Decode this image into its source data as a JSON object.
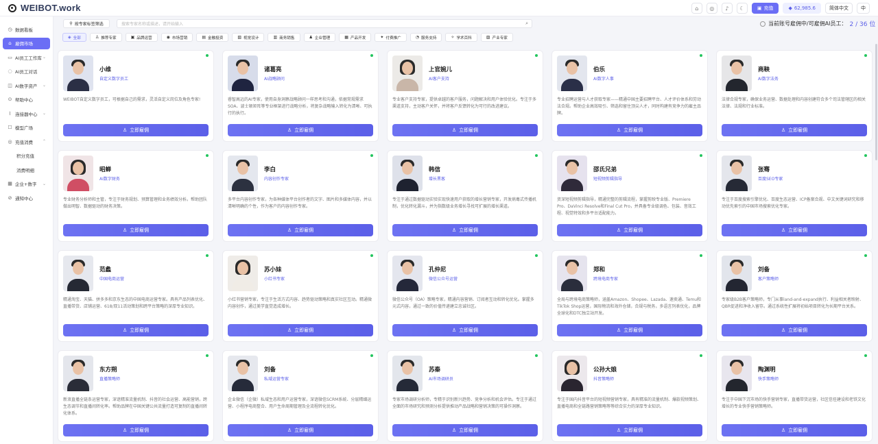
{
  "app": {
    "title": "WEIBOT.work"
  },
  "topbar": {
    "recharge": "充值",
    "points": "62,985.6",
    "lang": "简体中文",
    "lang2": "中"
  },
  "nav": [
    {
      "label": "数据看板",
      "icon": "◷",
      "active": false
    },
    {
      "label": "雇佣市场",
      "icon": "⌂",
      "active": true
    },
    {
      "label": "AI员工工作库",
      "icon": "▭",
      "active": false,
      "chev": "⌄"
    },
    {
      "label": "AI员工对话",
      "icon": "◌",
      "active": false
    },
    {
      "label": "AI数字资产",
      "icon": "◫",
      "active": false,
      "chev": "⌄"
    },
    {
      "label": "帮助中心",
      "icon": "⊙",
      "active": false
    },
    {
      "label": "连接器中心",
      "icon": "⌇",
      "active": false,
      "chev": "⌄"
    },
    {
      "label": "模型广场",
      "icon": "☐",
      "active": false
    },
    {
      "label": "充值消费",
      "icon": "◎",
      "active": false,
      "chev": "⌃"
    },
    {
      "label": "积分充值",
      "icon": "",
      "active": false,
      "sub": true
    },
    {
      "label": "消费明细",
      "icon": "",
      "active": false,
      "sub": true
    },
    {
      "label": "企业+数字",
      "icon": "▦",
      "active": false,
      "chev": "⌄"
    },
    {
      "label": "通知中心",
      "icon": "⊘",
      "active": false
    }
  ],
  "filter": {
    "label": "按专家标签筛选",
    "search_placeholder": "搜索专家名称或描述，请开始输入"
  },
  "hire_status": {
    "label": "当前账号雇佣中/可雇佣AI员工：",
    "count": "2 / 36 位"
  },
  "categories": [
    {
      "label": "全部",
      "icon": "◈",
      "active": true
    },
    {
      "label": "推荐专家",
      "icon": "♙",
      "active": false
    },
    {
      "label": "品牌运营",
      "icon": "▣",
      "active": false
    },
    {
      "label": "市场营销",
      "icon": "◉",
      "active": false
    },
    {
      "label": "金融投资",
      "icon": "▤",
      "active": false
    },
    {
      "label": "视觉设计",
      "icon": "▧",
      "active": false
    },
    {
      "label": "商务销售",
      "icon": "▥",
      "active": false
    },
    {
      "label": "企业管理",
      "icon": "♟",
      "active": false
    },
    {
      "label": "产品开发",
      "icon": "▦",
      "active": false
    },
    {
      "label": "付费推广",
      "icon": "✦",
      "active": false
    },
    {
      "label": "服务支持",
      "icon": "◔",
      "active": false
    },
    {
      "label": "学术百科",
      "icon": "✧",
      "active": false
    },
    {
      "label": "产业专家",
      "icon": "▨",
      "active": false
    }
  ],
  "hire_label": "立即雇佣",
  "cards": [
    {
      "name": "小维",
      "role": "自定义数字员工",
      "desc": "WEIBOT自定义数字员工，可根据自己的需求，灵活自定义岗位及角色专家!",
      "gender": "m",
      "suit": "#2b2f45",
      "bg": "#dfe3ef"
    },
    {
      "name": "诸葛亮",
      "role": "AI战略顾问",
      "desc": "睿智高远的AI专家，使用自身洞察战略顾问一样思考和沟通，依据常规需求SOA、波士顿矩阵等专业框架进行战略分析，将复杂战略输入转化为清晰、可执行的执行。",
      "gender": "m",
      "suit": "#1f2440",
      "bg": "#d7dcea"
    },
    {
      "name": "上官婉儿",
      "role": "AI客户支持",
      "desc": "专业客户支持专家，提供卓越的客户服务，问题解决和用户体验优化。专注于多渠道支持，主动客户关怀，并将客户反馈转化为可行的改进建议。",
      "gender": "f",
      "suit": "#c9b6a8",
      "bg": "#eceae7"
    },
    {
      "name": "伯乐",
      "role": "AI数字人事",
      "desc": "专业招聘运营与人才获取专家——精通中国主要招聘平台、人才评价体系和劳动法合规。帮助企业高效吸引、筛选和留住顶尖人才，同时构建有竞争力的雇主品牌。",
      "gender": "m",
      "suit": "#2a2f48",
      "bg": "#e3e6ee"
    },
    {
      "name": "商鞅",
      "role": "AI数字法务",
      "desc": "法律合规专家，确保业务运营、数据处理和内容创建符合多个司法管辖区的相关法律、法规和行业标准。",
      "gender": "m",
      "suit": "#23262e",
      "bg": "#e6e6e8"
    },
    {
      "name": "昭蝉",
      "role": "AI数字财务",
      "desc": "专业财务分析师和主管，专注于财务规划、预算管理和业务绩效分析。帮助团队做出明智、数据驱动的财务决策。",
      "gender": "f",
      "suit": "#d04e64",
      "bg": "#f0e4e6"
    },
    {
      "name": "李白",
      "role": "内容创作专家",
      "desc": "多平台内容创作专家，为各种媒体平台创作者的文字、图片和多媒体内容，并以清晰明确的个性，作为客户的内容创作专家。",
      "gender": "m",
      "suit": "#2c3140",
      "bg": "#e4e7ee"
    },
    {
      "name": "韩信",
      "role": "增长黑客",
      "desc": "专注于通过数据驱动实验实现快速用户获取的增长营销专家，开发病毒式传播机制，优化转化漏斗，并为指数级业务增长寻找可扩展的增长渠道。",
      "gender": "m",
      "suit": "#1e2230",
      "bg": "#dee1ea"
    },
    {
      "name": "邵氏兄弟",
      "role": "短视频剪辑指导",
      "desc": "资深短视频剪辑指导，精通完整的剪辑流程，掌握剪映专业版、Premiere Pro、DaVinci Resolve和Final Cut Pro，并具备专业级调色、包装、音效工程、视觉特效和多平台适配能力。",
      "gender": "m",
      "suit": "#2f2a3a",
      "bg": "#e6e2ee"
    },
    {
      "name": "张骞",
      "role": "百度SEO专家",
      "desc": "专注于百度搜索引擎优化、百度生态运营、ICP备案合规、中文关键词研究和移动优先索引的中国市场搜索优化专家。",
      "gender": "m",
      "suit": "#262a36",
      "bg": "#e4e6ec"
    },
    {
      "name": "范蠡",
      "role": "中国电商运营",
      "desc": "精通淘宝、天猫、拼多多和京东生态的中国电商运营专家。具有产品列表优化、直播带货、店铺运营、618/双11活动策划和跨平台策略的深厚专业知识。",
      "gender": "m",
      "suit": "#252934",
      "bg": "#e6e8ee"
    },
    {
      "name": "苏小妹",
      "role": "小红书专家",
      "desc": "小红书营销专家，专注于生活方式内容、趋势驱动策略和真实社区互动。精通微内容创作，通过美学直觉造成增长。",
      "gender": "f",
      "suit": "#f0ece6",
      "bg": "#efece8"
    },
    {
      "name": "孔仲尼",
      "role": "微信公众号运营",
      "desc": "微信公众号（OA）策略专家，精通内容营销、订阅者互动和转化优化。掌握多元式内容，通过一致的价值传递建立忠诚社区。",
      "gender": "m",
      "suit": "#24283a",
      "bg": "#e4e6ee"
    },
    {
      "name": "郑和",
      "role": "跨境电商专家",
      "desc": "全局与跨境电商策略师，涵盖Amazon、Shopee、Lazada、速卖通、Temu和TikTok Shop运营，国际物流和海外仓储，合规与税务，多语言列表优化，品牌全球化和DTC独立站开发。",
      "gender": "m",
      "suit": "#2a2e3c",
      "bg": "#e6e4ee"
    },
    {
      "name": "刘备",
      "role": "客户策略师",
      "desc": "专家级B2B客户策略师，专门从事land-and-expand执行、利益相关者映射、QBR促进和净收入留存。通过系统性扩展将初始项目转化为长期平台关系。",
      "gender": "m",
      "suit": "#232632",
      "bg": "#e2e5ec"
    },
    {
      "name": "东方朔",
      "role": "直播策略师",
      "desc": "新浪直播全链条运营专家，深谙精准流量机制、抖音的社会运营、高能营销，跨生态调节和直播间转化率。帮助品牌在中国关键公共流量打造可复制的直播间转化体系。",
      "gender": "m",
      "suit": "#2a2d38",
      "bg": "#e4e6ec"
    },
    {
      "name": "刘备",
      "role": "私域运营专家",
      "desc": "企业微信（企微）私域生态和用户运营专家，深谙微信SCRM系统、分层精细运营、小程序电商整合、用户生命周期管理及全流程转化优化。",
      "gender": "m",
      "suit": "#262b3a",
      "bg": "#e6e8ee"
    },
    {
      "name": "苏秦",
      "role": "AI市场调研员",
      "desc": "专家市场调研分析师，专精于识别新兴趋势、竞争分析和机会评估。专注于通过全面的市场研究和预测分析提供推动产品战略和营销决策的可操作洞察。",
      "gender": "m",
      "suit": "#252a38",
      "bg": "#e3e6ec"
    },
    {
      "name": "公孙大娘",
      "role": "抖音策略师",
      "desc": "专注于国内抖音平台的短视频营销专家，具有精准的流量机制、爆款视频策划、直播电商和全链路营销策略等等综合实力的深厚专业知识。",
      "gender": "f",
      "suit": "#2a2530",
      "bg": "#ece8ec"
    },
    {
      "name": "陶渊明",
      "role": "快手策略师",
      "desc": "专注于中国下沉市场的快手营销专家，直播带货运营，社区信任建设和老铁文化增长的专业快手营销策略师。",
      "gender": "m",
      "suit": "#23262e",
      "bg": "#e8e6ee"
    }
  ]
}
